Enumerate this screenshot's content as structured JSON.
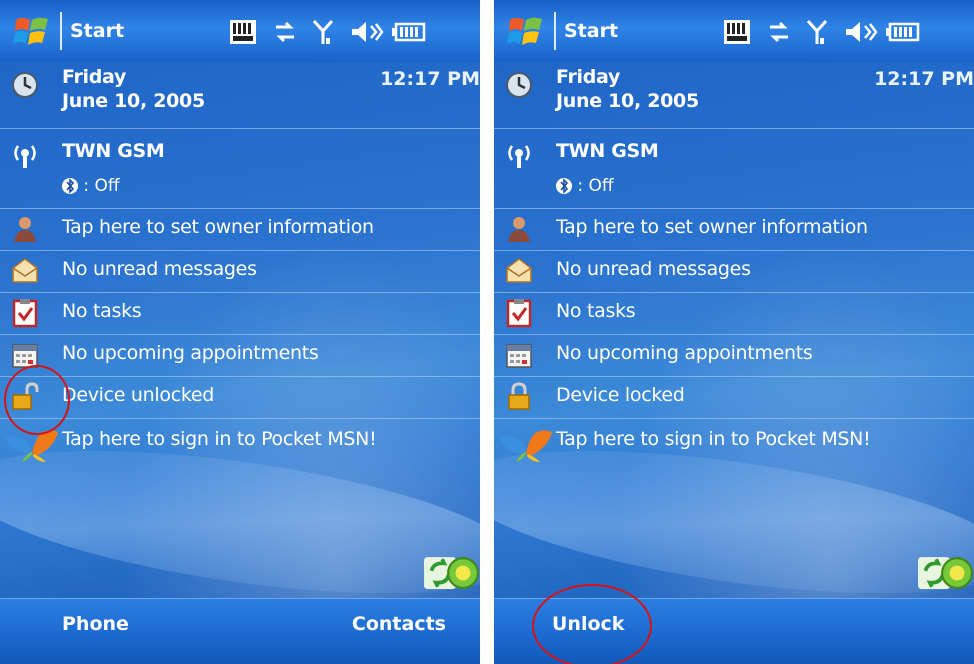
{
  "panels": [
    {
      "taskbar": {
        "start_label": "Start"
      },
      "date": {
        "weekday": "Friday",
        "date": "June 10, 2005",
        "time": "12:17 PM"
      },
      "network": {
        "carrier": "TWN GSM",
        "bluetooth": ": Off"
      },
      "items": {
        "owner": "Tap here to set owner information",
        "messages": "No unread messages",
        "tasks": "No tasks",
        "appointments": "No upcoming appointments",
        "lock": "Device unlocked",
        "msn": "Tap here to sign in to Pocket MSN!"
      },
      "softkeys": {
        "left": "Phone",
        "right": "Contacts"
      },
      "lock_state": "unlocked"
    },
    {
      "taskbar": {
        "start_label": "Start"
      },
      "date": {
        "weekday": "Friday",
        "date": "June 10, 2005",
        "time": "12:17 PM"
      },
      "network": {
        "carrier": "TWN GSM",
        "bluetooth": ": Off"
      },
      "items": {
        "owner": "Tap here to set owner information",
        "messages": "No unread messages",
        "tasks": "No tasks",
        "appointments": "No upcoming appointments",
        "lock": "Device locked",
        "msn": "Tap here to sign in to Pocket MSN!"
      },
      "softkeys": {
        "left": "Unlock",
        "right": ""
      },
      "lock_state": "locked"
    }
  ],
  "icons": [
    "windows-flag-icon",
    "keyboard-icon",
    "sync-arrows-icon",
    "signal-antenna-icon",
    "speaker-icon",
    "battery-icon",
    "clock-icon",
    "radio-icon",
    "bluetooth-icon",
    "owner-person-icon",
    "envelope-icon",
    "task-checkbox-icon",
    "calendar-icon",
    "lock-open-icon",
    "lock-closed-icon",
    "msn-butterfly-icon",
    "activesync-icon",
    "wireless-manager-icon"
  ],
  "colors": {
    "annotation_circle": "#d41414",
    "accent_blue": "#1e6cd2"
  }
}
